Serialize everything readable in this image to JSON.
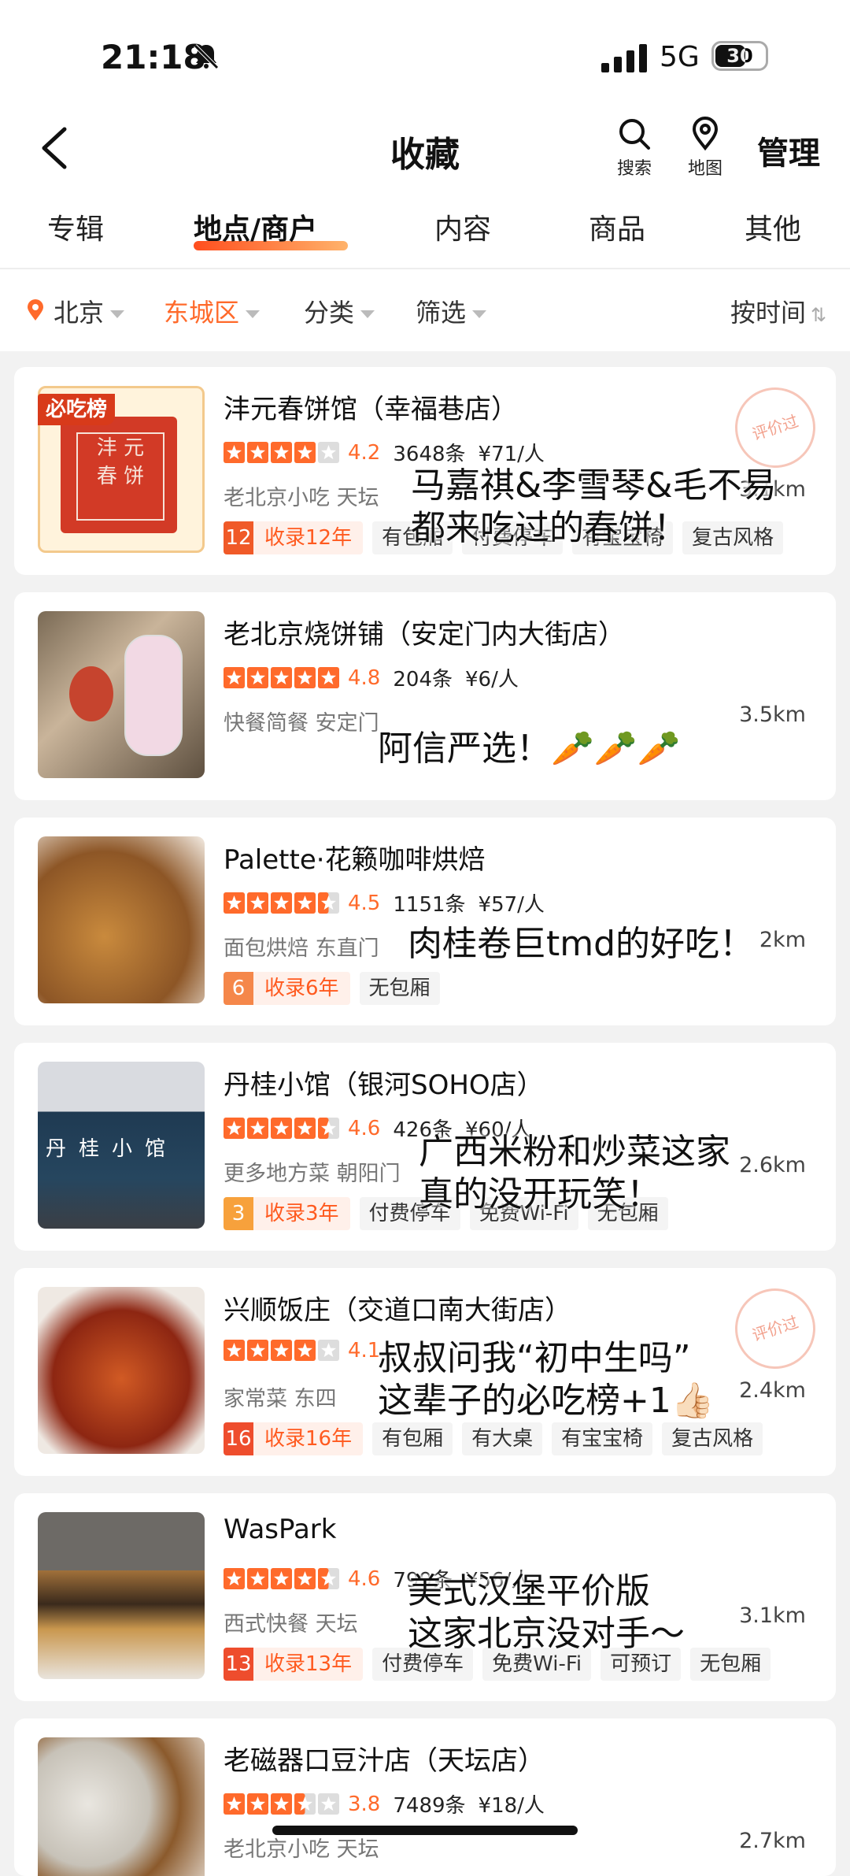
{
  "status": {
    "time": "21:18",
    "network": "5G",
    "battery": "30"
  },
  "nav": {
    "title": "收藏",
    "search_label": "搜索",
    "map_label": "地图",
    "manage_label": "管理"
  },
  "tabs": [
    "专辑",
    "地点/商户",
    "内容",
    "商品",
    "其他"
  ],
  "filters": {
    "city": "北京",
    "district": "东城区",
    "category": "分类",
    "filter": "筛选",
    "sort": "按时间"
  },
  "colors": {
    "accent": "#ff6a2b",
    "tag_bg": "#f4f4f4"
  },
  "badges": {
    "top_list": "必吃榜",
    "reviewed": "评价过"
  },
  "shops": [
    {
      "name": "沣元春饼馆（幸福巷店）",
      "stars": 4,
      "score": "4.2",
      "reviews": "3648条",
      "price": "¥71/人",
      "category": "老北京小吃 天坛",
      "distance": "3.1km",
      "years_num": "12",
      "years_label": "收录12年",
      "tags": [
        "有包厢",
        "付费停车",
        "有宝宝椅",
        "复古风格"
      ],
      "overlay": [
        "马嘉祺&李雪琴&毛不易",
        "都来吃过的春饼！"
      ]
    },
    {
      "name": "老北京烧饼铺（安定门内大街店）",
      "stars": 5,
      "score": "4.8",
      "reviews": "204条",
      "price": "¥6/人",
      "category": "快餐简餐 安定门",
      "distance": "3.5km",
      "overlay": [
        "阿信严选！🥕🥕🥕"
      ]
    },
    {
      "name": "Palette·花籁咖啡烘焙",
      "stars": 4.5,
      "score": "4.5",
      "reviews": "1151条",
      "price": "¥57/人",
      "category": "面包烘焙 东直门",
      "distance": "2km",
      "years_num": "6",
      "years_label": "收录6年",
      "tags": [
        "无包厢"
      ],
      "overlay": [
        "肉桂卷巨tmd的好吃！"
      ]
    },
    {
      "name": "丹桂小馆（银河SOHO店）",
      "stars": 4.5,
      "score": "4.6",
      "reviews": "426条",
      "price": "¥60/人",
      "category": "更多地方菜 朝阳门",
      "distance": "2.6km",
      "years_num": "3",
      "years_label": "收录3年",
      "tags": [
        "付费停车",
        "免费Wi-Fi",
        "无包厢"
      ],
      "overlay": [
        "广西米粉和炒菜这家",
        "真的没开玩笑！"
      ]
    },
    {
      "name": "兴顺饭庄（交道口南大街店）",
      "stars": 4,
      "score": "4.1",
      "reviews": "",
      "price": "",
      "category": "家常菜 东四",
      "distance": "2.4km",
      "years_num": "16",
      "years_label": "收录16年",
      "tags": [
        "有包厢",
        "有大桌",
        "有宝宝椅",
        "复古风格"
      ],
      "overlay": [
        "叔叔问我“初中生吗”",
        "这辈子的必吃榜+1👍🏻"
      ]
    },
    {
      "name": "WasPark",
      "stars": 4.5,
      "score": "4.6",
      "reviews": "799条",
      "price": "¥56/人",
      "category": "西式快餐 天坛",
      "distance": "3.1km",
      "years_num": "13",
      "years_label": "收录13年",
      "tags": [
        "付费停车",
        "免费Wi-Fi",
        "可预订",
        "无包厢"
      ],
      "overlay": [
        "美式汉堡平价版",
        "这家北京没对手～"
      ]
    },
    {
      "name": "老磁器口豆汁店（天坛店）",
      "stars": 3.5,
      "score": "3.8",
      "reviews": "7489条",
      "price": "¥18/人",
      "category": "老北京小吃 天坛",
      "distance": "2.7km"
    }
  ]
}
